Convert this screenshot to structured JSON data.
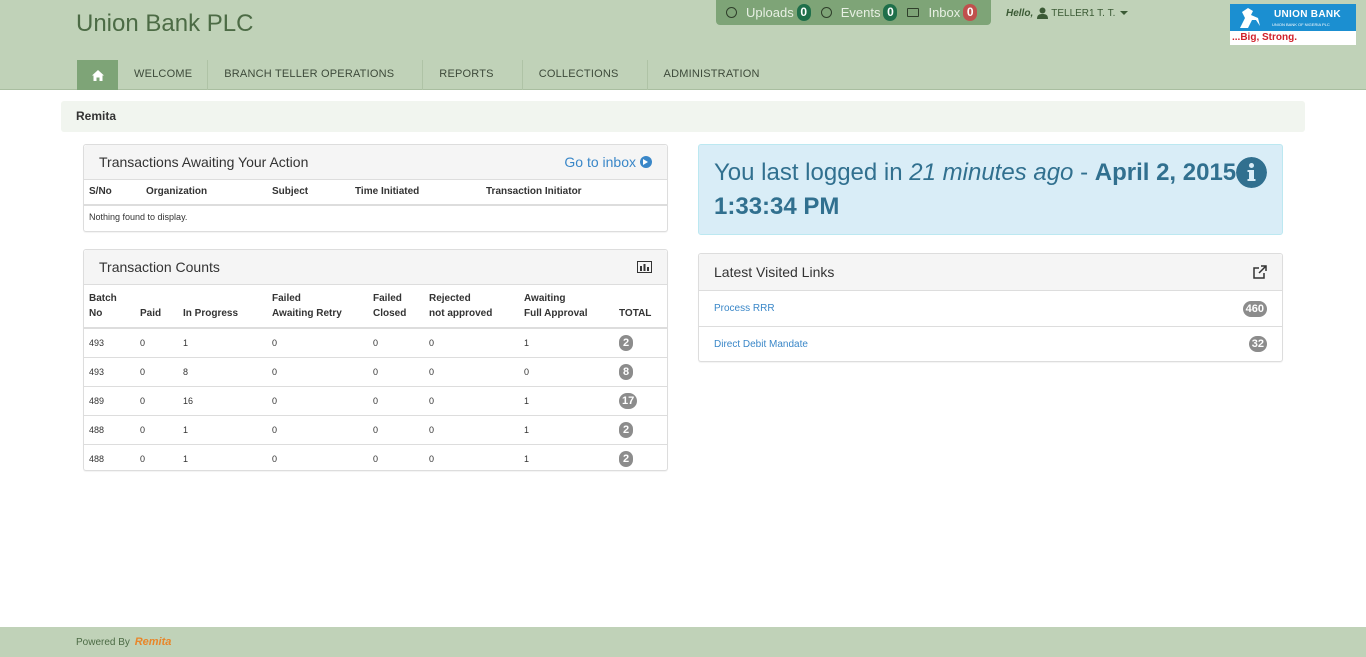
{
  "header": {
    "title": "Union Bank PLC",
    "notifications": [
      {
        "label": "Uploads",
        "count": "0",
        "color": "#1f6f4a"
      },
      {
        "label": "Events",
        "count": "0",
        "color": "#1f6f4a"
      },
      {
        "label": "Inbox",
        "count": "0",
        "color": "#c0504d"
      }
    ],
    "greeting": "Hello,",
    "user": "TELLER1 T. T.",
    "logo": {
      "brand": "UNION BANK",
      "sub": "UNION BANK OF NIGERIA PLC",
      "tagline": "...Big, Strong."
    }
  },
  "nav": {
    "items": [
      "WELCOME",
      "BRANCH TELLER OPERATIONS",
      "REPORTS",
      "COLLECTIONS",
      "ADMINISTRATION"
    ]
  },
  "breadcrumb": "Remita",
  "awaiting": {
    "title": "Transactions Awaiting Your Action",
    "inbox_link": "Go to inbox",
    "columns": [
      "S/No",
      "Organization",
      "Subject",
      "Time Initiated",
      "Transaction Initiator"
    ],
    "empty": "Nothing found to display."
  },
  "counts": {
    "title": "Transaction Counts",
    "columns": [
      {
        "l1": "Batch",
        "l2": "No"
      },
      {
        "l1": "",
        "l2": "Paid"
      },
      {
        "l1": "",
        "l2": "In Progress"
      },
      {
        "l1": "Failed",
        "l2": "Awaiting Retry"
      },
      {
        "l1": "Failed",
        "l2": "Closed"
      },
      {
        "l1": "Rejected",
        "l2": "not approved"
      },
      {
        "l1": "Awaiting",
        "l2": "Full Approval"
      },
      {
        "l1": "",
        "l2": "TOTAL"
      }
    ],
    "rows": [
      [
        "493",
        "0",
        "1",
        "0",
        "0",
        "0",
        "1",
        "2"
      ],
      [
        "493",
        "0",
        "8",
        "0",
        "0",
        "0",
        "0",
        "8"
      ],
      [
        "489",
        "0",
        "16",
        "0",
        "0",
        "0",
        "1",
        "17"
      ],
      [
        "488",
        "0",
        "1",
        "0",
        "0",
        "0",
        "1",
        "2"
      ],
      [
        "488",
        "0",
        "1",
        "0",
        "0",
        "0",
        "1",
        "2"
      ]
    ]
  },
  "login": {
    "prefix": "You last logged in",
    "ago": "21 minutes ago",
    "sep": "-",
    "date": "April 2, 2015 1:33:34 PM"
  },
  "links": {
    "title": "Latest Visited Links",
    "items": [
      {
        "label": "Process RRR",
        "count": "460"
      },
      {
        "label": "Direct Debit Mandate",
        "count": "32"
      }
    ]
  },
  "footer": {
    "powered": "Powered By",
    "brand": "Remita"
  }
}
